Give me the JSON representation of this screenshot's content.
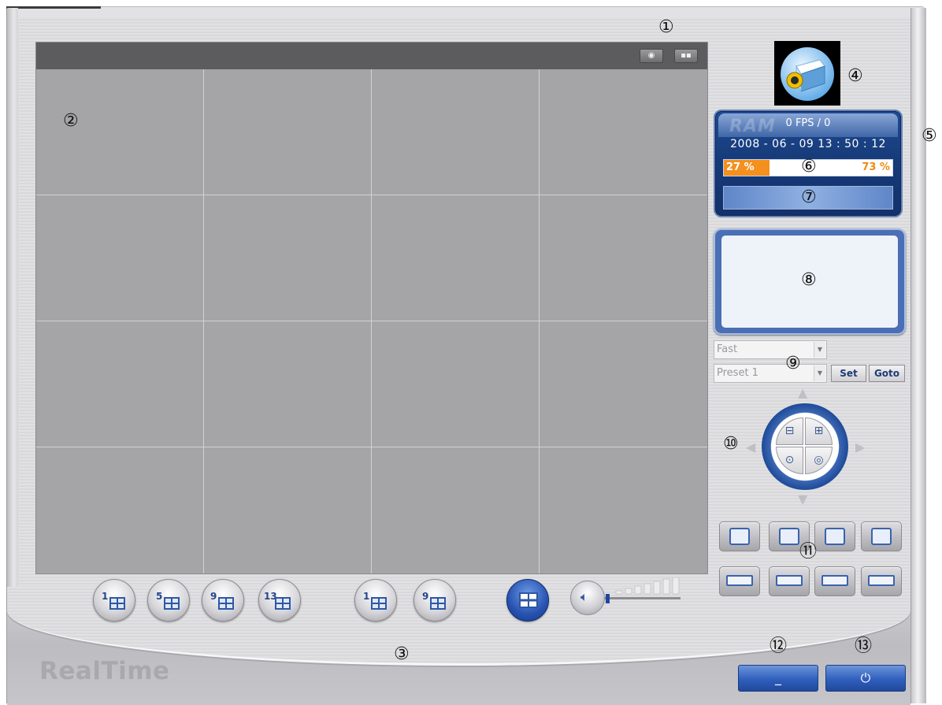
{
  "app": {
    "brand": "RealTime"
  },
  "callouts": [
    "①",
    "②",
    "③",
    "④",
    "⑤",
    "⑥",
    "⑦",
    "⑧",
    "⑨",
    "⑩",
    "⑪",
    "⑫",
    "⑬"
  ],
  "video_header": {
    "buttons": [
      {
        "icon": "snapshot-icon",
        "glyph": "◉"
      },
      {
        "icon": "record-icon",
        "glyph": "▪▪"
      }
    ]
  },
  "status_panel": {
    "fps": "0 FPS / 0",
    "datetime": "2008 - 06 - 09  13 : 50 : 12",
    "usage": {
      "left_label": "27 %",
      "right_label": "73 %",
      "fraction": 0.27
    },
    "watermark": "RAM"
  },
  "ptz": {
    "speed": {
      "value": "Fast"
    },
    "preset": {
      "value": "Preset 1"
    },
    "set_label": "Set",
    "goto_label": "Goto",
    "zoom_icons": [
      "zoom-out-icon",
      "zoom-in-icon",
      "focus-near-icon",
      "focus-far-icon"
    ]
  },
  "function_buttons": [
    {
      "icon": "connect-icon"
    },
    {
      "icon": "layout-edit-icon"
    },
    {
      "icon": "fullscreen-icon"
    },
    {
      "icon": "settings-icon"
    },
    {
      "icon": "playback-icon"
    },
    {
      "icon": "search-icon"
    },
    {
      "icon": "backup-icon"
    },
    {
      "icon": "remote-setup-icon"
    }
  ],
  "layout_buttons": [
    {
      "label": "1",
      "icon": "split-1-icon"
    },
    {
      "label": "5",
      "icon": "split-5-icon"
    },
    {
      "label": "9",
      "icon": "split-9-icon"
    },
    {
      "label": "13",
      "icon": "split-13-icon"
    },
    {
      "label": "1",
      "icon": "sequence-1-icon"
    },
    {
      "label": "9",
      "icon": "sequence-9-icon"
    },
    {
      "label": "",
      "icon": "split-16-icon",
      "active": true
    }
  ],
  "volume": {
    "level": 0.02,
    "icon": "speaker-icon"
  },
  "window_buttons": {
    "minimize_label": "_",
    "exit_label": "⏻"
  },
  "colors": {
    "accent": "#2f5fbd",
    "usage_fill": "#f3901e",
    "panel": "#1e4a92"
  }
}
